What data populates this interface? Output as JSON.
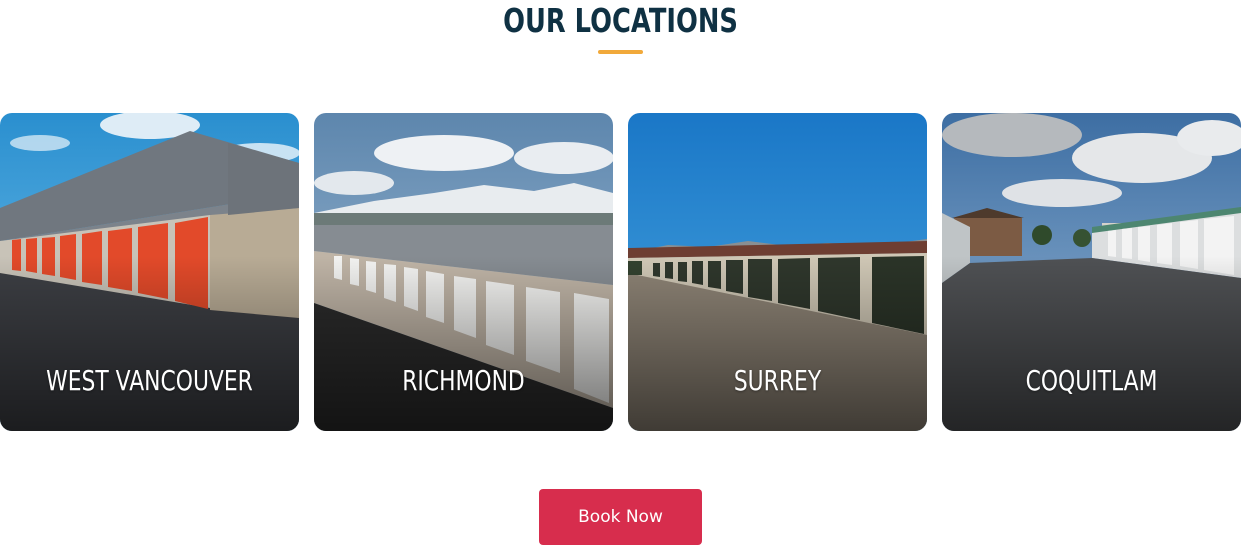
{
  "section": {
    "title": "OUR LOCATIONS",
    "accent_color": "#f1a93a",
    "title_color": "#0f3143"
  },
  "locations": [
    {
      "name": "WEST VANCOUVER"
    },
    {
      "name": "RICHMOND"
    },
    {
      "name": "SURREY"
    },
    {
      "name": "COQUITLAM"
    }
  ],
  "cta": {
    "label": "Book Now",
    "color": "#d72d4d"
  }
}
